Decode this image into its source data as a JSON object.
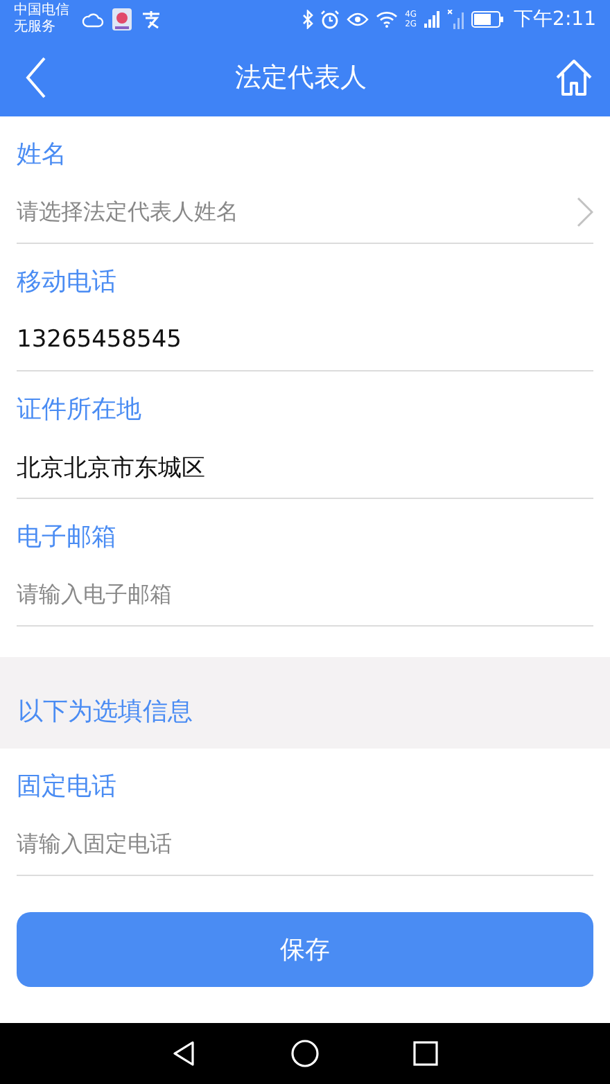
{
  "status_bar": {
    "carrier": "中国电信",
    "service": "无服务",
    "network_4g": "4G",
    "network_2g": "2G",
    "time": "下午2:11"
  },
  "header": {
    "title": "法定代表人"
  },
  "fields": [
    {
      "kind": "select",
      "label": "姓名",
      "placeholder": "请选择法定代表人姓名"
    },
    {
      "kind": "input",
      "label": "移动电话",
      "value": "13265458545"
    },
    {
      "kind": "input",
      "label": "证件所在地",
      "value": "北京北京市东城区"
    },
    {
      "kind": "input",
      "label": "电子邮箱",
      "placeholder": "请输入电子邮箱"
    }
  ],
  "optional_section": {
    "title": "以下为选填信息",
    "fields": [
      {
        "kind": "input",
        "label": "固定电话",
        "placeholder": "请输入固定电话"
      }
    ]
  },
  "save_button": "保存"
}
